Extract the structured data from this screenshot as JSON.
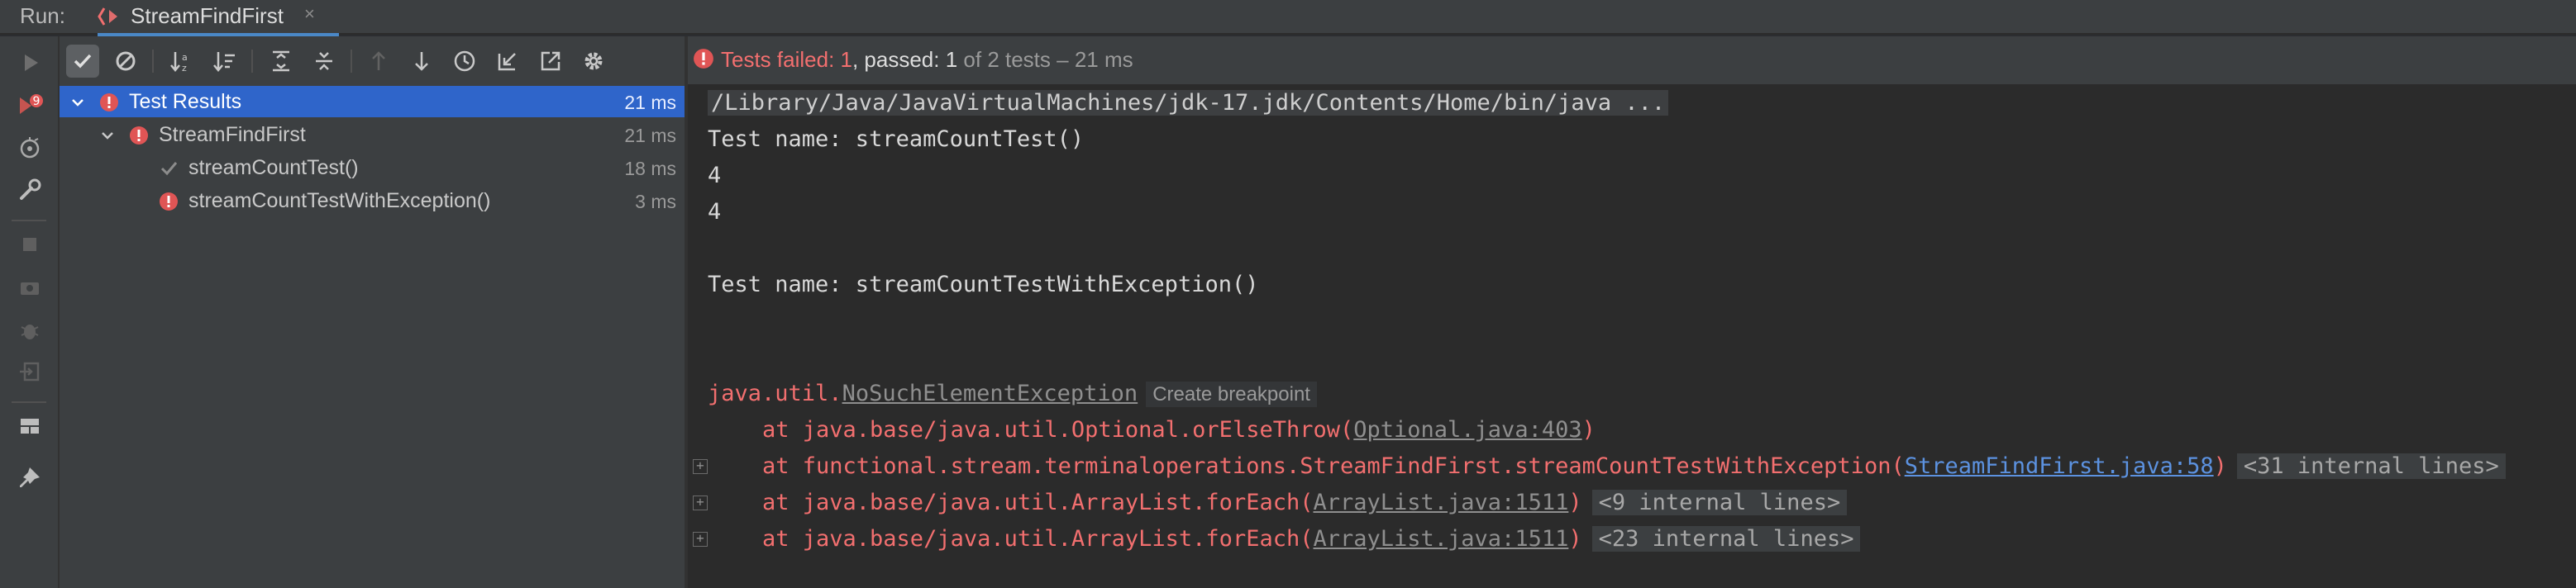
{
  "run_bar": {
    "label": "Run:",
    "tab_title": "StreamFindFirst",
    "tab_close": "×",
    "tab_icon": "run-config-icon"
  },
  "toolbar_icons": [
    "rerun-icon",
    "show-passed-icon",
    "show-ignored-icon",
    "sort-alphabetically-icon",
    "sort-by-duration-icon",
    "expand-all-icon",
    "collapse-all-icon",
    "previous-failed-icon",
    "next-failed-icon",
    "history-icon",
    "import-tests-icon",
    "export-tests-icon",
    "settings-icon"
  ],
  "left_strip_icons": [
    "rerun-failed-icon",
    "toggle-auto-test-icon",
    "settings-wrench-icon",
    "stop-icon",
    "screenshot-icon",
    "debug-icon",
    "exit-icon",
    "layout-icon",
    "pin-icon"
  ],
  "status": {
    "failed_label": "Tests failed: ",
    "failed_count": "1",
    "passed_label": ", passed: ",
    "passed_count": "1",
    "total_text": " of 2 tests – 21 ms"
  },
  "tree": {
    "items": [
      {
        "label": "Test Results",
        "time": "21 ms",
        "status": "failed",
        "selected": true
      },
      {
        "label": "StreamFindFirst",
        "time": "21 ms",
        "status": "failed"
      },
      {
        "label": "streamCountTest()",
        "time": "18 ms",
        "status": "passed"
      },
      {
        "label": "streamCountTestWithException()",
        "time": "3 ms",
        "status": "failed"
      }
    ]
  },
  "console": {
    "command": "/Library/Java/JavaVirtualMachines/jdk-17.jdk/Contents/Home/bin/java ...",
    "line1": "Test name: streamCountTest()",
    "line2": "4",
    "line3": "4",
    "line4": "Test name: streamCountTestWithException()",
    "exception_prefix": "java.util.",
    "exception_name": "NoSuchElementException",
    "create_breakpoint": "Create breakpoint",
    "trace": [
      {
        "text": "at java.base/java.util.Optional.orElseThrow(",
        "link": "Optional.java:403",
        "suffix": ")",
        "fold": ""
      },
      {
        "text": "at functional.stream.terminaloperations.StreamFindFirst.streamCountTestWithException(",
        "link": "StreamFindFirst.java:58",
        "suffix": ")",
        "fold": "<31 internal lines>"
      },
      {
        "text": "at java.base/java.util.ArrayList.forEach(",
        "link": "ArrayList.java:1511",
        "suffix": ")",
        "fold": "<9 internal lines>"
      },
      {
        "text": "at java.base/java.util.ArrayList.forEach(",
        "link": "ArrayList.java:1511",
        "suffix": ")",
        "fold": "<23 internal lines>"
      }
    ],
    "expand_glyph": "+"
  },
  "colors": {
    "selection": "#2f65ca",
    "error": "#f26f6f",
    "link": "#5c92e0",
    "pass": "#8c8c8c",
    "tab_underline": "#4a88c7"
  }
}
